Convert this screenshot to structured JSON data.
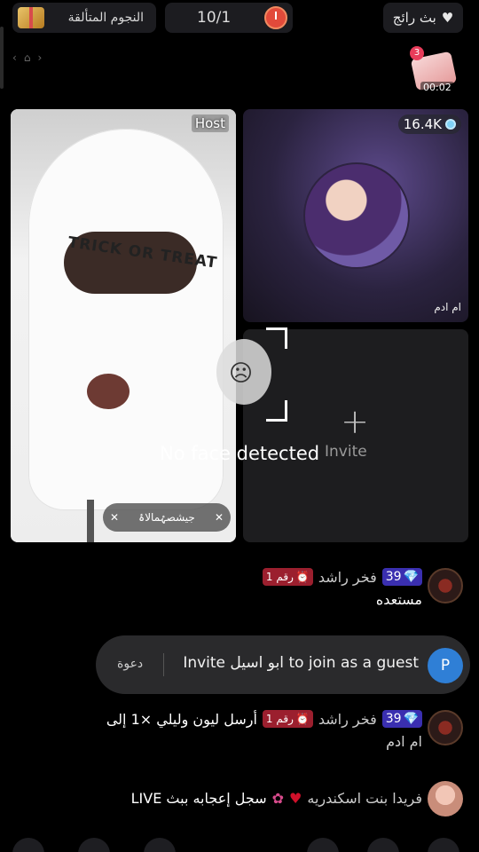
{
  "top_bar": {
    "stars_label": "النجوم المتألقة",
    "counter": "10/1",
    "host_label": "بث رائج"
  },
  "treasure": {
    "badge": "3",
    "timer": "00:02"
  },
  "host_card": {
    "label": "Host",
    "mask_text": "TRICK OR TREAT",
    "name_tag": "جيشصۂمالاۂ"
  },
  "guest_card": {
    "viewers": "16.4K",
    "name": "ام ادم"
  },
  "empty_card": {
    "plus": "+",
    "invite_label": "Invite"
  },
  "face_detection": {
    "message": "No face detected"
  },
  "chat": [
    {
      "user": "فخر راشد",
      "level": "39",
      "rank": "رقم 1",
      "text": "مستعده"
    },
    {
      "user": "فخر راشد",
      "level": "39",
      "rank": "رقم 1",
      "text": "أرسل ليون وليلي ×1 إلى",
      "text2": "ام ادم"
    },
    {
      "user": "فريدا بنت اسكندريه",
      "text": "سجل إعجابه ببث LIVE"
    }
  ],
  "invite_bar": {
    "avatar_letter": "P",
    "message": "Invite ابو اسيل to join as a guest",
    "button": "دعوة"
  }
}
